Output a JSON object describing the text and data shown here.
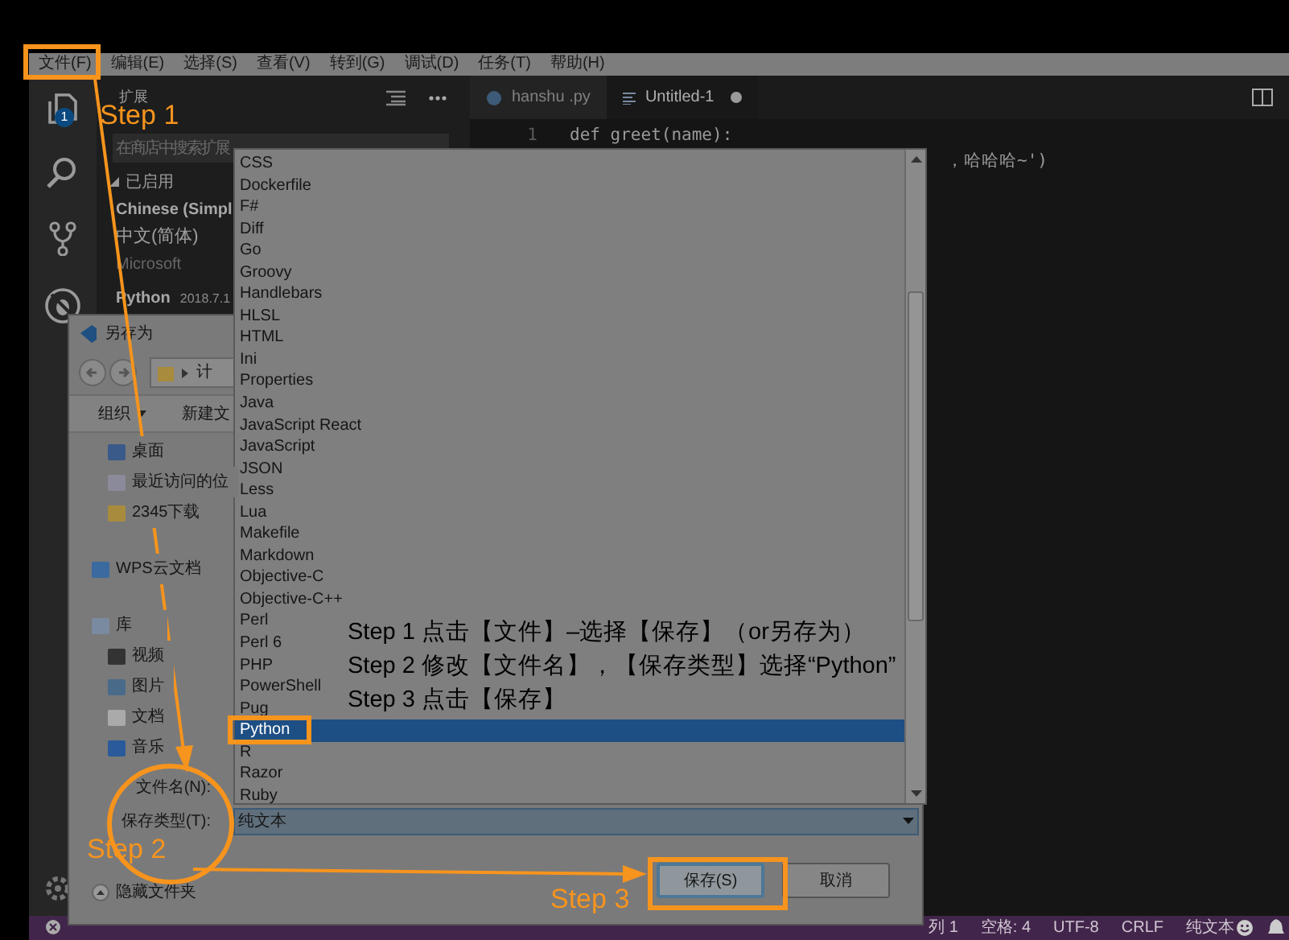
{
  "menu_bar": {
    "items": [
      {
        "label": "文件(F)"
      },
      {
        "label": "编辑(E)"
      },
      {
        "label": "选择(S)"
      },
      {
        "label": "查看(V)"
      },
      {
        "label": "转到(G)"
      },
      {
        "label": "调试(D)"
      },
      {
        "label": "任务(T)"
      },
      {
        "label": "帮助(H)"
      }
    ]
  },
  "activity_bar": {
    "badge": "1"
  },
  "sidebar": {
    "title": "扩展",
    "search": {
      "placeholder": "在商店中搜索扩展"
    },
    "section": "已启用",
    "extensions": [
      {
        "name": "Chinese (Simpl",
        "description": "中文(简体)",
        "publisher": "Microsoft"
      },
      {
        "name": "Python",
        "version": "2018.7.1"
      }
    ]
  },
  "editor": {
    "tabs": [
      {
        "label": "hanshu .py",
        "selected": false,
        "dirty": false
      },
      {
        "label": "Untitled-1",
        "selected": true,
        "dirty": true
      }
    ],
    "lines": [
      {
        "number": "1",
        "code": "def greet(name):"
      },
      {
        "code": "，哈哈哈~')"
      }
    ]
  },
  "status_bar": {
    "items": [
      "列 1",
      "空格: 4",
      "UTF-8",
      "CRLF",
      "纯文本"
    ]
  },
  "save_dialog": {
    "title": "另存为",
    "path": "计",
    "toolbar": [
      {
        "label": "组织",
        "dropdown": true
      },
      {
        "label": "新建文",
        "dropdown": false
      }
    ],
    "nav_items": [
      {
        "label": "桌面",
        "kind": "desktop"
      },
      {
        "label": "最近访问的位",
        "kind": "recent"
      },
      {
        "label": "2345下载",
        "kind": "folder"
      },
      {
        "label": "WPS云文档",
        "kind": "cloud"
      },
      {
        "label": "库",
        "kind": "library"
      },
      {
        "label": "视频",
        "kind": "video"
      },
      {
        "label": "图片",
        "kind": "picture"
      },
      {
        "label": "文档",
        "kind": "document"
      },
      {
        "label": "音乐",
        "kind": "music"
      }
    ],
    "file_name_label": "文件名(N):",
    "file_type_label": "保存类型(T):",
    "file_type_value": "纯文本",
    "hide_folders": "隐藏文件夹",
    "buttons": [
      {
        "label": "保存(S)",
        "default": true
      },
      {
        "label": "取消",
        "default": false
      }
    ]
  },
  "type_list": {
    "items": [
      {
        "label": "CSS",
        "selected": false
      },
      {
        "label": "Dockerfile",
        "selected": false
      },
      {
        "label": "F#",
        "selected": false
      },
      {
        "label": "Diff",
        "selected": false
      },
      {
        "label": "Go",
        "selected": false
      },
      {
        "label": "Groovy",
        "selected": false
      },
      {
        "label": "Handlebars",
        "selected": false
      },
      {
        "label": "HLSL",
        "selected": false
      },
      {
        "label": "HTML",
        "selected": false
      },
      {
        "label": "Ini",
        "selected": false
      },
      {
        "label": "Properties",
        "selected": false
      },
      {
        "label": "Java",
        "selected": false
      },
      {
        "label": "JavaScript React",
        "selected": false
      },
      {
        "label": "JavaScript",
        "selected": false
      },
      {
        "label": "JSON",
        "selected": false
      },
      {
        "label": "Less",
        "selected": false
      },
      {
        "label": "Lua",
        "selected": false
      },
      {
        "label": "Makefile",
        "selected": false
      },
      {
        "label": "Markdown",
        "selected": false
      },
      {
        "label": "Objective-C",
        "selected": false
      },
      {
        "label": "Objective-C++",
        "selected": false
      },
      {
        "label": "Perl",
        "selected": false
      },
      {
        "label": "Perl 6",
        "selected": false
      },
      {
        "label": "PHP",
        "selected": false
      },
      {
        "label": "PowerShell",
        "selected": false
      },
      {
        "label": "Pug",
        "selected": false
      },
      {
        "label": "Python",
        "selected": true
      },
      {
        "label": "R",
        "selected": false
      },
      {
        "label": "Razor",
        "selected": false
      },
      {
        "label": "Ruby",
        "selected": false
      }
    ]
  },
  "annotations": {
    "steps": [
      "Step 1",
      "Step 2",
      "Step 3"
    ],
    "instructions": [
      "Step 1 点击【文件】–选择【保存】（or另存为）",
      "Step 2 修改【文件名】，【保存类型】选择“Python”",
      "Step 3 点击【保存】"
    ]
  }
}
